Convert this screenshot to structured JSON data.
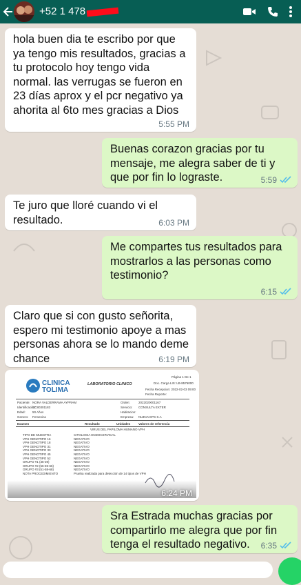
{
  "header": {
    "contact_name": "+52 1 478",
    "back_icon": "arrow-left-icon",
    "icons": [
      "video-call-icon",
      "phone-icon",
      "more-vertical-icon"
    ]
  },
  "messages": [
    {
      "dir": "in",
      "text": "hola buen dia te escribo por que\nya tengo mis resultados, gracias a\ntu protocolo hoy tengo vida\nnormal. las verrugas se fueron en\n23 días aprox y el pcr negativo ya\nahorita al 6to mes gracias a Dios",
      "time": "5:55 PM"
    },
    {
      "dir": "out",
      "text": "Buenas corazon gracias por tu\nmensaje, me alegra saber de ti y\nque por fin lo lograste.",
      "time": "5:59",
      "status": "read"
    },
    {
      "dir": "in",
      "text": "Te juro que lloré cuando vi el\nresultado.",
      "time": "6:03 PM"
    },
    {
      "dir": "out",
      "text": "Me compartes tus resultados para\nmostrarlos a las personas como\ntestimonio?",
      "time": "6:15",
      "status": "read"
    },
    {
      "dir": "in",
      "text": "Claro que si con gusto señorita,\nespero mi testimonio apoye a mas\npersonas ahora se lo mando deme\nchance",
      "time": "6:19 PM"
    },
    {
      "dir": "out",
      "text": "Sra Estrada muchas gracias por\ncompartirlo me alegra que por fin\ntenga el resultado negativo.",
      "time": "6:35",
      "status": "read"
    }
  ],
  "image_message": {
    "time": "6:24 PM",
    "document": {
      "logo_line1": "CLINICA",
      "logo_line2": "TOLIMA",
      "heading": "LABORATORIO CLINICO",
      "page": "Página 1 De 1",
      "doc_code": "Doc. Carga LIS: LB-8576000",
      "fecha_recepcion": "Fecha Recepcion: 2022-02-03 09:00",
      "fecha_reporte": "Fecha Reporte:",
      "label_paciente": "Paciente:",
      "label_identificacion": "Identificación:",
      "label_edad": "Edad:",
      "label_genero": "Genero:",
      "label_orden": "Orden:",
      "label_servicio": "Servicio:",
      "label_habitacion": "Habitacion:",
      "label_empresa": "Empresa:",
      "paciente": "NORA VALDERRAMA AYPRAM",
      "identificacion": "CC80301183",
      "edad": "50 Años",
      "genero": "Femenino",
      "orden": "2022020001167",
      "servicio": "CONSULTA EXTER",
      "empresa": "NUEVA EPS S.A",
      "col_examen": "Examen",
      "col_resultado": "Resultado",
      "col_unidades": "Unidades",
      "col_valores": "Valores de referencia",
      "test_title": "VIRUS DEL PAPILOMA HUMANO VPH",
      "result_rows": [
        [
          "TIPO DE MUESTRA",
          "CITOLOGIA ENDOCERVICAL"
        ],
        [
          "VPH GENOTIPO 16",
          "NEGATIVO"
        ],
        [
          "VPH GENOTIPO 18",
          "NEGATIVO"
        ],
        [
          "VPH GENOTIPO 31",
          "NEGATIVO"
        ],
        [
          "VPH GENOTIPO 33",
          "NEGATIVO"
        ],
        [
          "VPH GENOTIPO 45",
          "NEGATIVO"
        ],
        [
          "VPH GENOTIPO 52",
          "NEGATIVO"
        ],
        [
          "GRUPO #1 (35-39)",
          "NEGATIVO"
        ],
        [
          "GRUPO #2 (56-59-66)",
          "NEGATIVO"
        ],
        [
          "GRUPO #3 (51-58-68)",
          "NEGATIVO"
        ],
        [
          "NOTA PROCEDIMIENTO",
          "Prueba realizada para detección de 14 tipos de VPH"
        ]
      ]
    }
  },
  "colors": {
    "header_bg": "#075e54",
    "incoming_bubble": "#ffffff",
    "outgoing_bubble": "#dcf8c6",
    "read_ticks": "#53bdeb",
    "redaction": "#ff0c1a"
  }
}
